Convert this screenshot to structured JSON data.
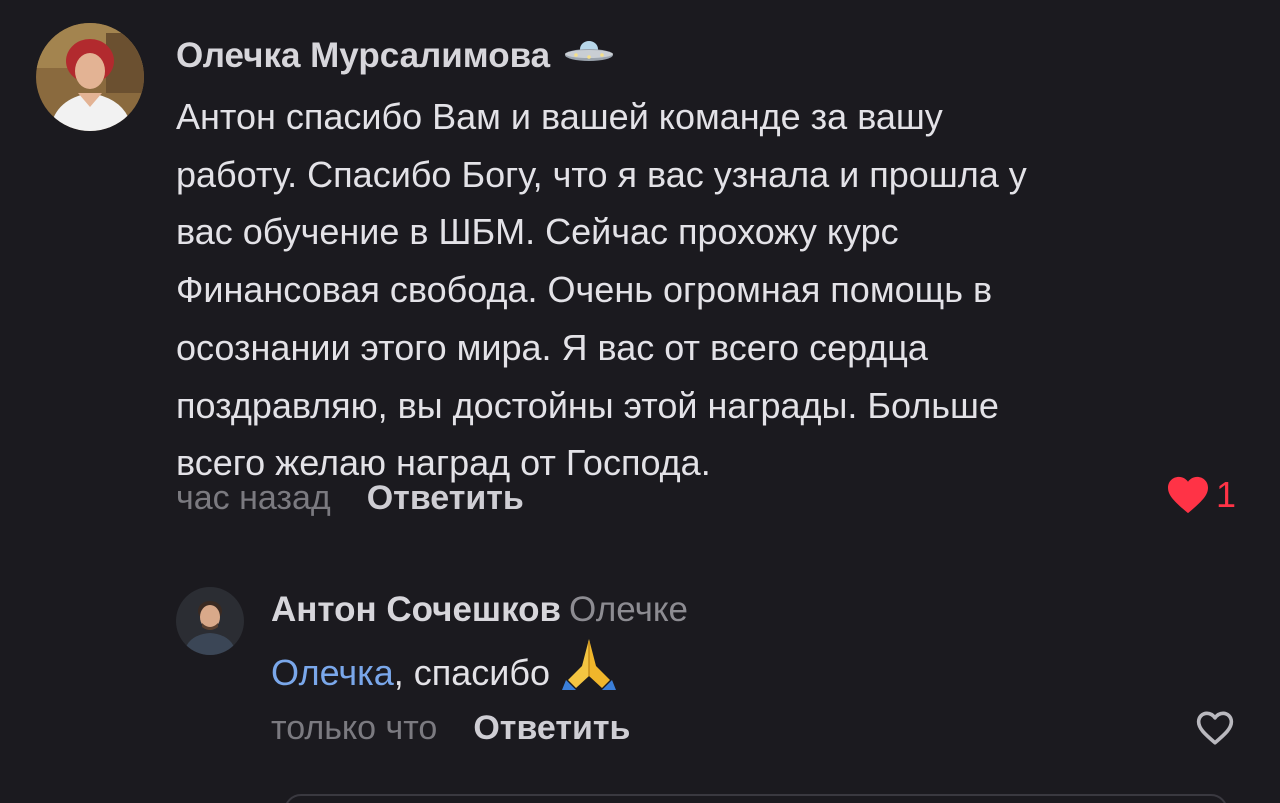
{
  "comment": {
    "author": "Олечка Мурсалимова",
    "author_emoji": "ufo-icon",
    "text": "Антон спасибо Вам и вашей команде за вашу\nработу. Спасибо Богу, что я вас узнала и прошла у\nвас обучение в ШБМ. Сейчас прохожу курс\nФинансовая свобода. Очень огромная помощь в\nосознании этого мира. Я вас от всего сердца\nпоздравляю, вы достойны этой награды. Больше\nвсего желаю наград от Господа.",
    "time": "час назад",
    "reply_label": "Ответить",
    "likes": "1",
    "liked": true
  },
  "reply": {
    "author": "Антон Сочешков",
    "reply_to": "Олечке",
    "mention": "Олечка",
    "text": ", спасибо ",
    "emoji": "folded-hands-icon",
    "time": "только что",
    "reply_label": "Ответить",
    "liked": false
  },
  "colors": {
    "background": "#1b1a1f",
    "like_active": "#ff3346",
    "mention": "#7aa7ea"
  }
}
